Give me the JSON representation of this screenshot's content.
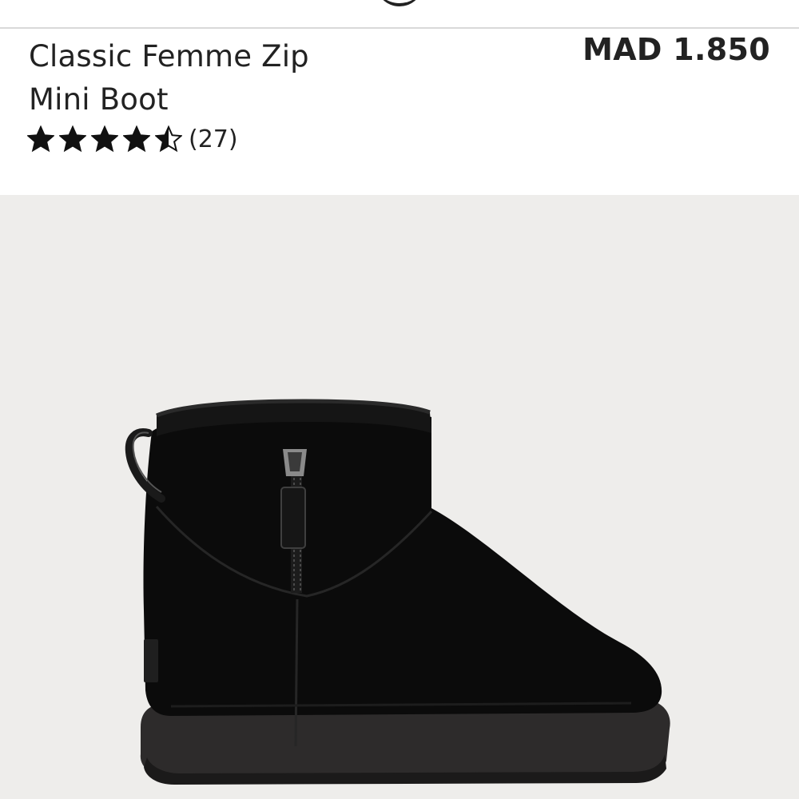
{
  "product": {
    "title_line1": "Classic Femme Zip",
    "title_line2": "Mini Boot",
    "price": "MAD 1.850",
    "rating": {
      "stars_filled": 4.5,
      "stars_total": 5,
      "review_count_label": "(27)"
    },
    "image": {
      "icon": "boot-product-image",
      "background": "#eeedeb",
      "boot_color": "#0b0b0b"
    }
  },
  "colors": {
    "text": "#222222",
    "divider": "#d9d9d9"
  }
}
